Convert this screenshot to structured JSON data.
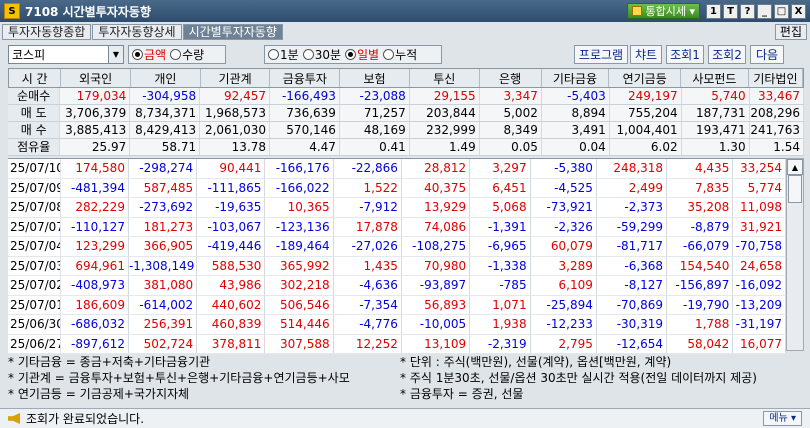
{
  "window": {
    "title": "7108 시간별투자자동향",
    "app_icon_text": "S",
    "combo": "통합시세",
    "btns": [
      "1",
      "T",
      "?",
      "_",
      "□",
      "X"
    ]
  },
  "tabs": [
    "투자자동향종합",
    "투자자동향상세",
    "시간별투자자동향"
  ],
  "edit_label": "편집",
  "toolbar": {
    "market": "코스피",
    "unit_opts": [
      "금액",
      "수량"
    ],
    "period_opts": [
      "1분",
      "30분",
      "일별",
      "누적"
    ],
    "buttons": [
      "프로그램",
      "챠트",
      "조회1",
      "조회2",
      "다음"
    ]
  },
  "columns": [
    "시 간",
    "외국인",
    "개인",
    "기관계",
    "금융투자",
    "보험",
    "투신",
    "은행",
    "기타금융",
    "연기금등",
    "사모펀드",
    "기타법인"
  ],
  "summary": [
    {
      "label": "순매수",
      "vals": [
        "179,034",
        "-304,958",
        "92,457",
        "-166,493",
        "-23,088",
        "29,155",
        "3,347",
        "-5,403",
        "249,197",
        "5,740",
        "33,467"
      ]
    },
    {
      "label": "매 도",
      "vals": [
        "3,706,379",
        "8,734,371",
        "1,968,573",
        "736,639",
        "71,257",
        "203,844",
        "5,002",
        "8,894",
        "755,204",
        "187,731",
        "208,296"
      ]
    },
    {
      "label": "매 수",
      "vals": [
        "3,885,413",
        "8,429,413",
        "2,061,030",
        "570,146",
        "48,169",
        "232,999",
        "8,349",
        "3,491",
        "1,004,401",
        "193,471",
        "241,763"
      ]
    },
    {
      "label": "점유율",
      "vals": [
        "25.97",
        "58.71",
        "13.78",
        "4.47",
        "0.41",
        "1.49",
        "0.05",
        "0.04",
        "6.02",
        "1.30",
        "1.54"
      ]
    }
  ],
  "rows": [
    {
      "date": "25/07/10",
      "vals": [
        "174,580",
        "-298,274",
        "90,441",
        "-166,176",
        "-22,866",
        "28,812",
        "3,297",
        "-5,380",
        "248,318",
        "4,435",
        "33,254"
      ]
    },
    {
      "date": "25/07/09",
      "vals": [
        "-481,394",
        "587,485",
        "-111,865",
        "-166,022",
        "1,522",
        "40,375",
        "6,451",
        "-4,525",
        "2,499",
        "7,835",
        "5,774"
      ]
    },
    {
      "date": "25/07/08",
      "vals": [
        "282,229",
        "-273,692",
        "-19,635",
        "10,365",
        "-7,912",
        "13,929",
        "5,068",
        "-73,921",
        "-2,373",
        "35,208",
        "11,098"
      ]
    },
    {
      "date": "25/07/07",
      "vals": [
        "-110,127",
        "181,273",
        "-103,067",
        "-123,136",
        "17,878",
        "74,086",
        "-1,391",
        "-2,326",
        "-59,299",
        "-8,879",
        "31,921"
      ]
    },
    {
      "date": "25/07/04",
      "vals": [
        "123,299",
        "366,905",
        "-419,446",
        "-189,464",
        "-27,026",
        "-108,275",
        "-6,965",
        "60,079",
        "-81,717",
        "-66,079",
        "-70,758"
      ]
    },
    {
      "date": "25/07/03",
      "vals": [
        "694,961",
        "-1,308,149",
        "588,530",
        "365,992",
        "1,435",
        "70,980",
        "-1,338",
        "3,289",
        "-6,368",
        "154,540",
        "24,658"
      ]
    },
    {
      "date": "25/07/02",
      "vals": [
        "-408,973",
        "381,080",
        "43,986",
        "302,218",
        "-4,636",
        "-93,897",
        "-785",
        "6,109",
        "-8,127",
        "-156,897",
        "-16,092"
      ]
    },
    {
      "date": "25/07/01",
      "vals": [
        "186,609",
        "-614,002",
        "440,602",
        "506,546",
        "-7,354",
        "56,893",
        "1,071",
        "-25,894",
        "-70,869",
        "-19,790",
        "-13,209"
      ]
    },
    {
      "date": "25/06/30",
      "vals": [
        "-686,032",
        "256,391",
        "460,839",
        "514,446",
        "-4,776",
        "-10,005",
        "1,938",
        "-12,233",
        "-30,319",
        "1,788",
        "-31,197"
      ]
    },
    {
      "date": "25/06/27",
      "vals": [
        "-897,612",
        "502,724",
        "378,811",
        "307,588",
        "12,252",
        "13,109",
        "-2,319",
        "2,795",
        "-12,654",
        "58,042",
        "16,077"
      ]
    }
  ],
  "notes_left": [
    "* 기타금융 = 종금+저축+기타금융기관",
    "* 기관계 = 금융투자+보험+투신+은행+기타금융+연기금등+사모",
    "* 연기금등 = 기금공제+국가지자체"
  ],
  "notes_right": [
    "* 단위 : 주식(백만원), 선물(계약), 옵션[백만원, 계약)",
    "* 주식 1분30초, 선물/옵션 30초만 실시간 적용(전일 데이터까지 제공)",
    "* 금융투자 = 증권, 선물"
  ],
  "status": {
    "message": "조회가 완료되었습니다.",
    "menu": "메뉴 ▾"
  },
  "colors": {
    "positive": "#e00000",
    "negative": "#0000e0",
    "title_bg": "#2e4d6e"
  }
}
